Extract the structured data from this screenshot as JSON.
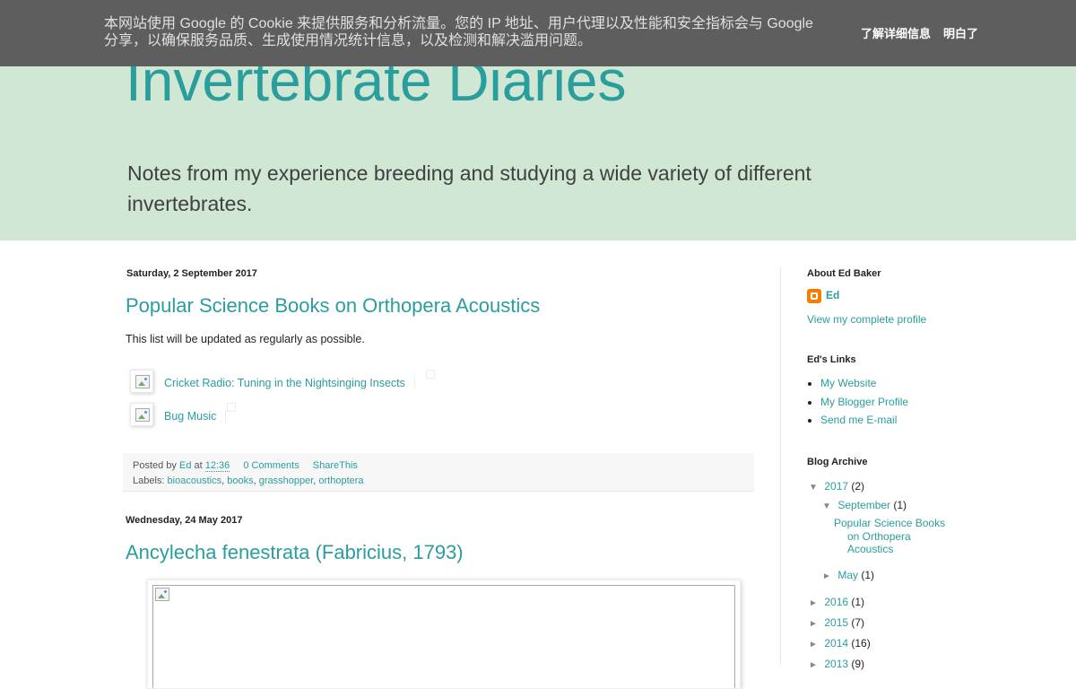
{
  "cookie": {
    "text": "本网站使用 Google 的 Cookie 来提供服务和分析流量。您的 IP 地址、用户代理以及性能和安全指标会与 Google 分享，以确保服务品质、生成使用情况统计信息，以及检测和解决滥用问题。",
    "more_label": "了解详细信息",
    "ok_label": "明白了"
  },
  "header": {
    "title": "Invertebrate Diaries",
    "description": "Notes from my experience breeding and studying a wide variety of different invertebrates."
  },
  "posts": [
    {
      "date": "Saturday, 2 September 2017",
      "title": "Popular Science Books on Orthopera Acoustics",
      "body": "This list will be updated as regularly as possible.",
      "books": [
        {
          "title": "Cricket Radio: Tuning in the Nightsinging Insects"
        },
        {
          "title": "Bug Music"
        }
      ],
      "footer": {
        "posted_by": "Posted by",
        "author": "Ed",
        "at": "at",
        "time": "12:36",
        "comments": "0 Comments",
        "share": "ShareThis",
        "labels_prefix": "Labels:",
        "labels": [
          "bioacoustics",
          "books",
          "grasshopper",
          "orthoptera"
        ]
      }
    },
    {
      "date": "Wednesday, 24 May 2017",
      "title": "Ancylecha fenestrata (Fabricius, 1793)"
    }
  ],
  "sidebar": {
    "about": {
      "title": "About Ed Baker",
      "name": "Ed",
      "profile_link": "View my complete profile"
    },
    "links": {
      "title": "Ed's Links",
      "items": [
        "My Website",
        "My Blogger Profile",
        "Send me E-mail"
      ]
    },
    "archive": {
      "title": "Blog Archive",
      "years": [
        {
          "year": "2017",
          "count": "(2)",
          "toggle": "▼"
        },
        {
          "year": "2016",
          "count": "(1)",
          "toggle": "►"
        },
        {
          "year": "2015",
          "count": "(7)",
          "toggle": "►"
        },
        {
          "year": "2014",
          "count": "(16)",
          "toggle": "►"
        },
        {
          "year": "2013",
          "count": "(9)",
          "toggle": "►"
        }
      ],
      "months": [
        {
          "month": "September",
          "count": "(1)",
          "toggle": "▼"
        },
        {
          "month": "May",
          "count": "(1)",
          "toggle": "►"
        }
      ],
      "post_line1": "Popular Science Books",
      "post_line2": "on Orthopera",
      "post_line3": "Acoustics"
    }
  },
  "colors": {
    "accent": "#2a9d9d",
    "header_bg": "#cfe7d3",
    "cookie_bg": "#5e5e5e"
  }
}
